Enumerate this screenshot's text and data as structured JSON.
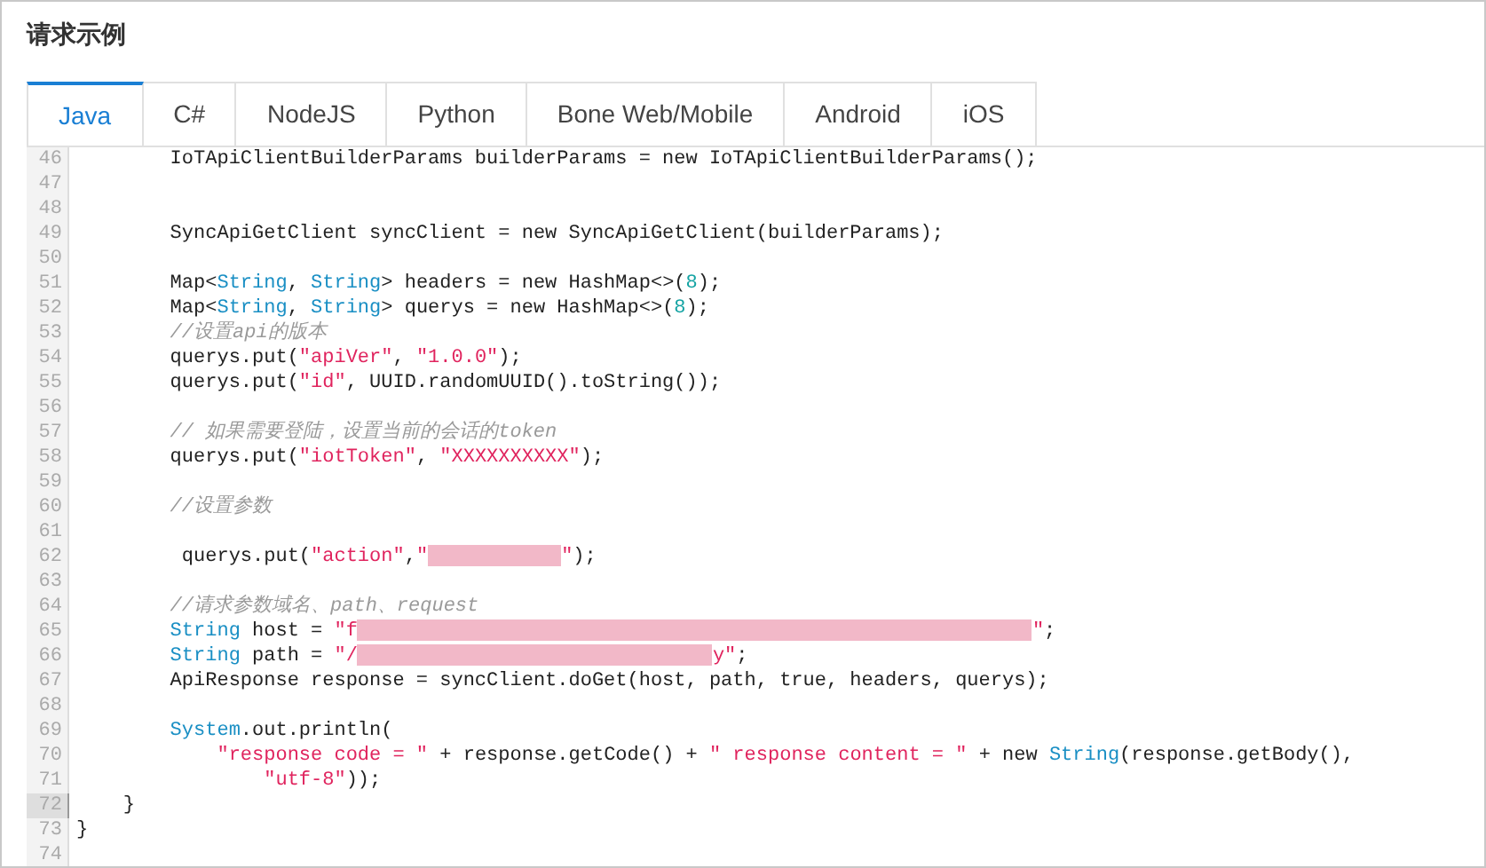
{
  "title": "请求示例",
  "tabs": [
    {
      "label": "Java",
      "selected": true
    },
    {
      "label": "C#",
      "selected": false
    },
    {
      "label": "NodeJS",
      "selected": false
    },
    {
      "label": "Python",
      "selected": false
    },
    {
      "label": "Bone Web/Mobile",
      "selected": false
    },
    {
      "label": "Android",
      "selected": false
    },
    {
      "label": "iOS",
      "selected": false
    }
  ],
  "code_lines": [
    {
      "number": "46",
      "active": false,
      "tokens": [
        {
          "kind": "plain",
          "text": "        IoTApiClientBuilderParams builderParams = new IoTApiClientBuilderParams();"
        }
      ]
    },
    {
      "number": "47",
      "active": false
    },
    {
      "number": "48",
      "active": false
    },
    {
      "number": "49",
      "active": false,
      "tokens": [
        {
          "kind": "plain",
          "text": "        SyncApiGetClient syncClient = new SyncApiGetClient(builderParams);"
        }
      ]
    },
    {
      "number": "50",
      "active": false
    },
    {
      "number": "51",
      "active": false,
      "tokens": [
        {
          "kind": "plain",
          "text": "        Map<"
        },
        {
          "kind": "type",
          "text": "String"
        },
        {
          "kind": "plain",
          "text": ", "
        },
        {
          "kind": "type",
          "text": "String"
        },
        {
          "kind": "plain",
          "text": "> headers = new HashMap<>("
        },
        {
          "kind": "number",
          "text": "8"
        },
        {
          "kind": "plain",
          "text": ");"
        }
      ]
    },
    {
      "number": "52",
      "active": false,
      "tokens": [
        {
          "kind": "plain",
          "text": "        Map<"
        },
        {
          "kind": "type",
          "text": "String"
        },
        {
          "kind": "plain",
          "text": ", "
        },
        {
          "kind": "type",
          "text": "String"
        },
        {
          "kind": "plain",
          "text": "> querys = new HashMap<>("
        },
        {
          "kind": "number",
          "text": "8"
        },
        {
          "kind": "plain",
          "text": ");"
        }
      ]
    },
    {
      "number": "53",
      "active": false,
      "tokens": [
        {
          "kind": "comment",
          "text": "        //设置api的版本"
        }
      ]
    },
    {
      "number": "54",
      "active": false,
      "tokens": [
        {
          "kind": "plain",
          "text": "        querys.put("
        },
        {
          "kind": "string",
          "text": "\"apiVer\""
        },
        {
          "kind": "plain",
          "text": ", "
        },
        {
          "kind": "string",
          "text": "\"1.0.0\""
        },
        {
          "kind": "plain",
          "text": ");"
        }
      ]
    },
    {
      "number": "55",
      "active": false,
      "tokens": [
        {
          "kind": "plain",
          "text": "        querys.put("
        },
        {
          "kind": "string",
          "text": "\"id\""
        },
        {
          "kind": "plain",
          "text": ", UUID.randomUUID().toString());"
        }
      ]
    },
    {
      "number": "56",
      "active": false
    },
    {
      "number": "57",
      "active": false,
      "tokens": [
        {
          "kind": "comment",
          "text": "        // 如果需要登陆，设置当前的会话的token"
        }
      ]
    },
    {
      "number": "58",
      "active": false,
      "tokens": [
        {
          "kind": "plain",
          "text": "        querys.put("
        },
        {
          "kind": "string",
          "text": "\"iotToken\""
        },
        {
          "kind": "plain",
          "text": ", "
        },
        {
          "kind": "string",
          "text": "\"XXXXXXXXXX\""
        },
        {
          "kind": "plain",
          "text": ");"
        }
      ]
    },
    {
      "number": "59",
      "active": false
    },
    {
      "number": "60",
      "active": false,
      "tokens": [
        {
          "kind": "comment",
          "text": "        //设置参数"
        }
      ]
    },
    {
      "number": "61",
      "active": false
    },
    {
      "number": "62",
      "active": false,
      "tokens": [
        {
          "kind": "plain",
          "text": "         querys.put("
        },
        {
          "kind": "string",
          "text": "\"action\""
        },
        {
          "kind": "plain",
          "text": ","
        },
        {
          "kind": "string",
          "text": "\""
        },
        {
          "kind": "redacted_short"
        },
        {
          "kind": "string",
          "text": "\""
        },
        {
          "kind": "plain",
          "text": ");"
        }
      ]
    },
    {
      "number": "63",
      "active": false
    },
    {
      "number": "64",
      "active": false,
      "tokens": [
        {
          "kind": "comment",
          "text": "        //请求参数域名、path、request"
        }
      ]
    },
    {
      "number": "65",
      "active": false,
      "tokens": [
        {
          "kind": "type",
          "text": "        String"
        },
        {
          "kind": "plain",
          "text": " host = "
        },
        {
          "kind": "string",
          "text": "\"f"
        },
        {
          "kind": "redacted_long"
        },
        {
          "kind": "string",
          "text": "\""
        },
        {
          "kind": "plain",
          "text": ";"
        }
      ]
    },
    {
      "number": "66",
      "active": false,
      "tokens": [
        {
          "kind": "type",
          "text": "        String"
        },
        {
          "kind": "plain",
          "text": " path = "
        },
        {
          "kind": "string",
          "text": "\"/"
        },
        {
          "kind": "redacted_medium"
        },
        {
          "kind": "string",
          "text": "y\""
        },
        {
          "kind": "plain",
          "text": ";"
        }
      ]
    },
    {
      "number": "67",
      "active": false,
      "tokens": [
        {
          "kind": "plain",
          "text": "        ApiResponse response = syncClient.doGet(host, path, true, headers, querys);"
        }
      ]
    },
    {
      "number": "68",
      "active": false
    },
    {
      "number": "69",
      "active": false,
      "tokens": [
        {
          "kind": "type",
          "text": "        System"
        },
        {
          "kind": "plain",
          "text": ".out.println("
        }
      ]
    },
    {
      "number": "70",
      "active": false,
      "tokens": [
        {
          "kind": "string",
          "text": "            \"response code = \""
        },
        {
          "kind": "plain",
          "text": " + response.getCode() + "
        },
        {
          "kind": "string",
          "text": "\" response content = \""
        },
        {
          "kind": "plain",
          "text": " + new "
        },
        {
          "kind": "type",
          "text": "String"
        },
        {
          "kind": "plain",
          "text": "(response.getBody(),"
        }
      ]
    },
    {
      "number": "71",
      "active": false,
      "tokens": [
        {
          "kind": "string",
          "text": "                \"utf-8\""
        },
        {
          "kind": "plain",
          "text": "));"
        }
      ]
    },
    {
      "number": "72",
      "active": true,
      "tokens": [
        {
          "kind": "plain",
          "text": "    }"
        }
      ]
    },
    {
      "number": "73",
      "active": false,
      "tokens": [
        {
          "kind": "plain",
          "text": "}"
        }
      ]
    },
    {
      "number": "74",
      "active": false
    }
  ]
}
